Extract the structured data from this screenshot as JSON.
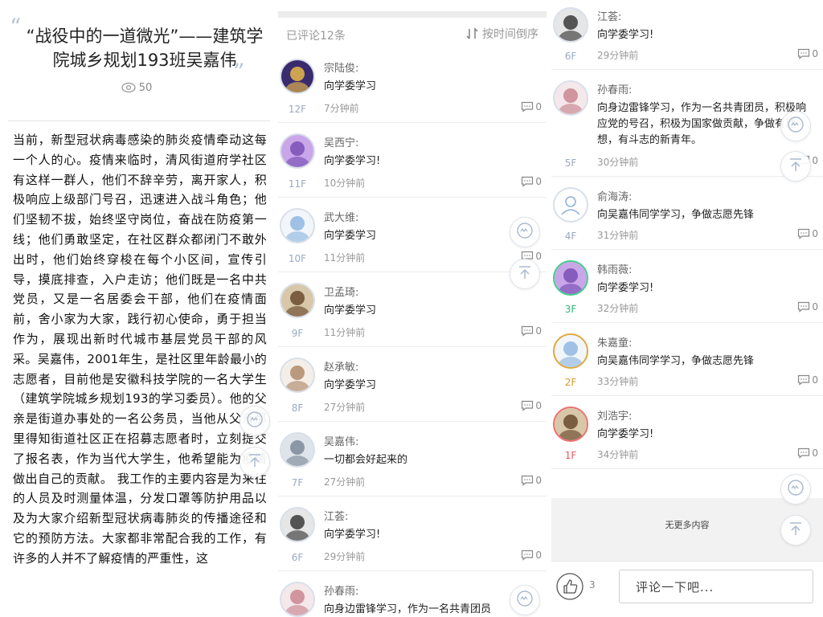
{
  "article": {
    "quote_open": "“",
    "quote_close": "”",
    "title": "“战役中的一道微光”——建筑学院城乡规划193班吴嘉伟",
    "views": "50",
    "body": "当前，新型冠状病毒感染的肺炎疫情牵动这每一个人的心。疫情来临时，清风街道府学社区有这样一群人，他们不辞辛劳，离开家人，积极响应上级部门号召，迅速进入战斗角色；他们坚韧不拔，始终坚守岗位，奋战在防疫第一线；他们勇敢坚定，在社区群众都闭门不敢外出时，他们始终穿梭在每个小区间，宣传引导，摸底排查，入户走访；他们既是一名中共党员，又是一名居委会干部，他们在疫情面前，舍小家为大家，践行初心使命，勇于担当作为，展现出新时代城市基层党员干部的风采。吴嘉伟，2001年生，是社区里年龄最小的志愿者，目前他是安徽科技学院的一名大学生（建筑学院城乡规划193的学习委员）。他的父亲是街道办事处的一名公务员，当他从父亲那里得知街道社区正在招募志愿者时，立刻提交了报名表，作为当代大学生，他希望能为疫情做出自己的贡献。 我工作的主要内容是为来往的人员及时测量体温，分发口罩等防护用品以及为大家介绍新型冠状病毒肺炎的传播途径和它的预防方法。大家都非常配合我的工作，有许多的人并不了解疫情的严重性，这"
  },
  "list": {
    "count_label": "已评论12条",
    "sort_label": "按时间倒序"
  },
  "panel_b_comments": [
    {
      "name": "宗陆俊:",
      "text": "向学委学习",
      "floor": "12F",
      "time": "7分钟前",
      "replies": "0",
      "ring": "#d8dfe9"
    },
    {
      "name": "吴西宁:",
      "text": "向学委学习!",
      "floor": "11F",
      "time": "10分钟前",
      "replies": "0",
      "ring": "#d8dfe9"
    },
    {
      "name": "武大维:",
      "text": "向学委学习",
      "floor": "10F",
      "time": "11分钟前",
      "replies": "0",
      "ring": "#d8dfe9"
    },
    {
      "name": "卫孟琦:",
      "text": "向学委学习",
      "floor": "9F",
      "time": "11分钟前",
      "replies": "0",
      "ring": "#d8dfe9"
    },
    {
      "name": "赵承敏:",
      "text": "向学委学习",
      "floor": "8F",
      "time": "27分钟前",
      "replies": "0",
      "ring": "#d8dfe9"
    },
    {
      "name": "吴嘉伟:",
      "text": "一切都会好起来的",
      "floor": "7F",
      "time": "27分钟前",
      "replies": "0",
      "ring": "#d8dfe9"
    },
    {
      "name": "江荟:",
      "text": "向学委学习!",
      "floor": "6F",
      "time": "29分钟前",
      "replies": "0",
      "ring": "#d8dfe9"
    },
    {
      "name": "孙春雨:",
      "text": "向身边雷锋学习，作为一名共青团员",
      "floor": "5F",
      "time": "",
      "replies": "",
      "ring": "#d8dfe9"
    }
  ],
  "panel_c_comments": [
    {
      "name": "江荟:",
      "text": "向学委学习!",
      "floor": "6F",
      "time": "29分钟前",
      "replies": "0",
      "ring": "#d8dfe9"
    },
    {
      "name": "孙春雨:",
      "text": "向身边雷锋学习，作为一名共青团员，积极响应党的号召，积极为国家做贡献，争做有理想，有斗志的新青年。",
      "floor": "5F",
      "time": "30分钟前",
      "replies": "0",
      "ring": "#d8dfe9"
    },
    {
      "name": "俞海涛:",
      "text": "向吴嘉伟同学学习，争做志愿先锋",
      "floor": "4F",
      "time": "31分钟前",
      "replies": "0",
      "ring": "#d8dfe9"
    },
    {
      "name": "韩雨薇:",
      "text": "向学委学习!",
      "floor": "3F",
      "time": "32分钟前",
      "replies": "0",
      "ring": "#3fce8a",
      "floor_color": "#2fb872"
    },
    {
      "name": "朱嘉童:",
      "text": "向吴嘉伟同学学习，争做志愿先锋",
      "floor": "2F",
      "time": "33分钟前",
      "replies": "0",
      "ring": "#e0a838",
      "floor_color": "#d49a28"
    },
    {
      "name": "刘浩宇:",
      "text": "向学委学习!",
      "floor": "1F",
      "time": "34分钟前",
      "replies": "0",
      "ring": "#ef6f6f",
      "floor_color": "#e45a5a"
    }
  ],
  "footer": {
    "no_more": "无更多内容",
    "like_count": "3",
    "comment_placeholder": "评论一下吧..."
  },
  "colors": {
    "accent": "#9aa9c2",
    "gold": "#d49a28",
    "green": "#2fb872",
    "red": "#e45a5a"
  }
}
